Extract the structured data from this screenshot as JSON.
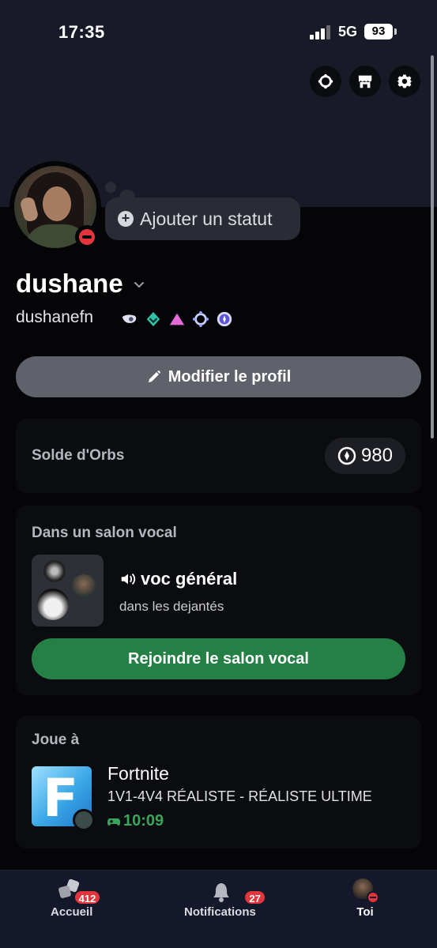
{
  "status_bar": {
    "time": "17:35",
    "network": "5G",
    "battery": "93"
  },
  "header_actions": [
    {
      "icon": "nitro-icon"
    },
    {
      "icon": "shop-icon"
    },
    {
      "icon": "gear-icon"
    }
  ],
  "profile": {
    "status_placeholder": "Ajouter un statut",
    "display_name": "dushane",
    "username": "dushanefn",
    "presence": "do-not-disturb",
    "badges": [
      "hypesquad-icon",
      "nitro-gem-icon",
      "quest-triangle-icon",
      "boost-icon",
      "orb-badge-icon"
    ],
    "edit_label": "Modifier le profil"
  },
  "orbs": {
    "title": "Solde d'Orbs",
    "balance": "980"
  },
  "voice": {
    "title": "Dans un salon vocal",
    "channel": "voc général",
    "server": "dans les dejantés",
    "join_label": "Rejoindre le salon vocal"
  },
  "game": {
    "title": "Joue à",
    "name": "Fortnite",
    "detail": "1V1-4V4 RÉALISTE - RÉALISTE ULTIME",
    "elapsed": "10:09"
  },
  "tabs": [
    {
      "label": "Accueil",
      "badge": "412"
    },
    {
      "label": "Notifications",
      "badge": "27"
    },
    {
      "label": "Toi",
      "badge": ""
    }
  ],
  "colors": {
    "background": "#050508",
    "banner": "#181a28",
    "card": "#0b0c10",
    "join_green": "#248045",
    "danger_red": "#e3363c",
    "tabbar": "#15172a"
  }
}
